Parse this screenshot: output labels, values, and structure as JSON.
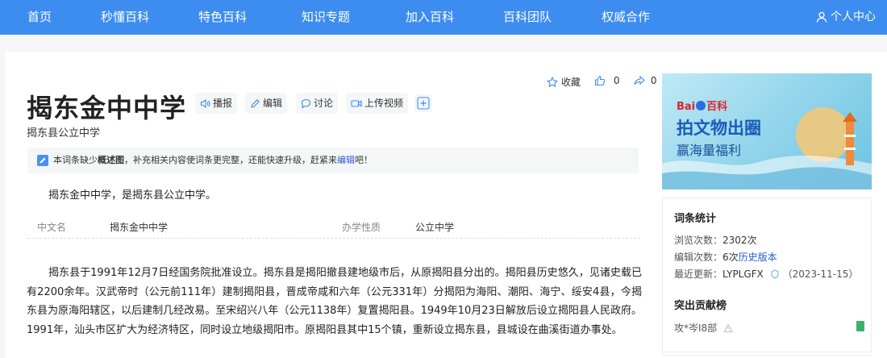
{
  "nav": {
    "items": [
      "首页",
      "秒懂百科",
      "特色百科",
      "知识专题",
      "加入百科",
      "百科团队",
      "权威合作"
    ],
    "user": "个人中心"
  },
  "entry": {
    "title": "揭东金中中学",
    "subtitle": "揭东县公立中学",
    "buttons": {
      "broadcast": "播报",
      "edit": "编辑",
      "discuss": "讨论",
      "upload_video": "上传视频"
    },
    "actions": {
      "collect": "收藏",
      "like_count": "0",
      "share_count": "0"
    },
    "notice": {
      "before": "本词条缺少",
      "bold": "概述图",
      "middle": "，补充相关内容使词条更完整，还能快速升级，赶紧来",
      "link": "编辑",
      "after": "吧！"
    },
    "summary": "揭东金中中学，是揭东县公立中学。",
    "info": {
      "label1": "中文名",
      "value1": "揭东金中中学",
      "label2": "办学性质",
      "value2": "公立中学"
    },
    "body": "揭东县于1991年12月7日经国务院批准设立。揭东县是揭阳撤县建地级市后，从原揭阳县分出的。揭阳县历史悠久，见诸史载已有2200余年。汉武帝时（公元前111年）建制揭阳县，晋成帝咸和六年（公元331年）分揭阳为海阳、潮阳、海宁、绥安4县，今揭东县为原海阳辖区，以后建制几经改易。至宋绍兴八年（公元1138年）复置揭阳县。1949年10月23日解放后设立揭阳县人民政府。1991年，汕头市区扩大为经济特区，同时设立地级揭阳市。原揭阳县其中15个镇，重新设立揭东县，县城设在曲溪街道办事处。"
  },
  "banner": {
    "logo_text_1": "Bai",
    "logo_text_2": "百科",
    "headline": "拍文物出圈",
    "tagline": "赢海量福利"
  },
  "stats": {
    "title": "词条统计",
    "views_label": "浏览次数：",
    "views_value": "2302次",
    "edits_label": "编辑次数：",
    "edits_value": "6次",
    "edits_link": "历史版本",
    "updated_label": "最近更新：",
    "updated_user": "LYPLGFX",
    "updated_date": "（2023-11-15）",
    "contrib_title": "突出贡献榜",
    "contrib_name": "攻*岑I8部"
  },
  "colors": {
    "nav_bg": "#3d8cf0",
    "link": "#2a5bd7",
    "page_bg": "#f5f6f8"
  }
}
